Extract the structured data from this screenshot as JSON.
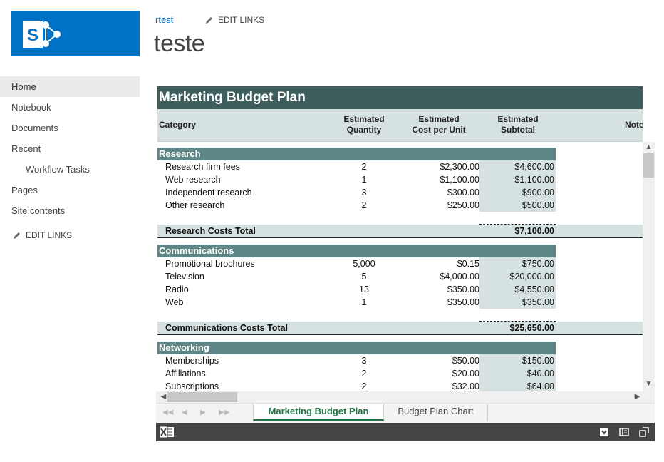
{
  "brand": {
    "logo_letter": "S",
    "color": "#0072c6"
  },
  "header": {
    "site_link": "rtest",
    "edit_links": "EDIT LINKS",
    "page_title": "teste"
  },
  "leftnav": {
    "items": [
      {
        "label": "Home",
        "selected": true
      },
      {
        "label": "Notebook"
      },
      {
        "label": "Documents"
      },
      {
        "label": "Recent"
      },
      {
        "label": "Workflow Tasks",
        "sub": true
      },
      {
        "label": "Pages"
      },
      {
        "label": "Site contents"
      }
    ],
    "edit_links": "EDIT LINKS"
  },
  "workbook": {
    "title": "Marketing Budget Plan",
    "columns": {
      "category": "Category",
      "qty_line1": "Estimated",
      "qty_line2": "Quantity",
      "cost_line1": "Estimated",
      "cost_line2": "Cost per Unit",
      "sub_line1": "Estimated",
      "sub_line2": "Subtotal",
      "notes": "Note"
    },
    "sections": [
      {
        "name": "Research",
        "rows": [
          {
            "item": "Research firm fees",
            "qty": "2",
            "cost": "$2,300.00",
            "subtotal": "$4,600.00"
          },
          {
            "item": "Web research",
            "qty": "1",
            "cost": "$1,100.00",
            "subtotal": "$1,100.00"
          },
          {
            "item": "Independent research",
            "qty": "3",
            "cost": "$300.00",
            "subtotal": "$900.00"
          },
          {
            "item": "Other research",
            "qty": "2",
            "cost": "$250.00",
            "subtotal": "$500.00"
          }
        ],
        "total_label": "Research Costs Total",
        "total": "$7,100.00"
      },
      {
        "name": "Communications",
        "rows": [
          {
            "item": "Promotional brochures",
            "qty": "5,000",
            "cost": "$0.15",
            "subtotal": "$750.00"
          },
          {
            "item": "Television",
            "qty": "5",
            "cost": "$4,000.00",
            "subtotal": "$20,000.00"
          },
          {
            "item": "Radio",
            "qty": "13",
            "cost": "$350.00",
            "subtotal": "$4,550.00"
          },
          {
            "item": "Web",
            "qty": "1",
            "cost": "$350.00",
            "subtotal": "$350.00"
          }
        ],
        "total_label": "Communications Costs Total",
        "total": "$25,650.00"
      },
      {
        "name": "Networking",
        "rows": [
          {
            "item": "Memberships",
            "qty": "3",
            "cost": "$50.00",
            "subtotal": "$150.00"
          },
          {
            "item": "Affiliations",
            "qty": "2",
            "cost": "$20.00",
            "subtotal": "$40.00"
          },
          {
            "item": "Subscriptions",
            "qty": "2",
            "cost": "$32.00",
            "subtotal": "$64.00"
          }
        ]
      }
    ],
    "sheet_tabs": [
      {
        "label": "Marketing Budget Plan",
        "active": true
      },
      {
        "label": "Budget Plan Chart",
        "active": false
      }
    ],
    "colors": {
      "title_bg": "#3e5e5e",
      "section_bg": "#5f8686",
      "band_bg": "#d6e2e2",
      "active_tab": "#217346",
      "status_bar": "#444444"
    }
  }
}
